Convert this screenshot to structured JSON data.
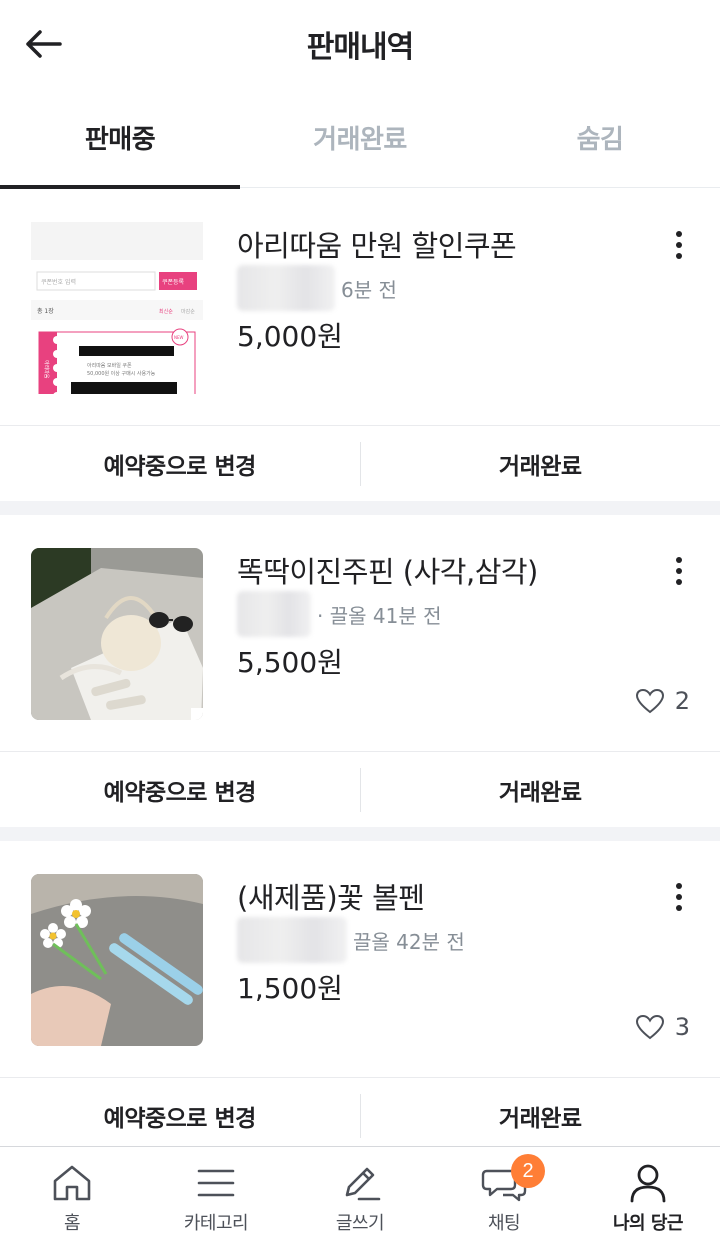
{
  "header": {
    "title": "판매내역"
  },
  "tabs": [
    {
      "label": "판매중",
      "active": true
    },
    {
      "label": "거래완료",
      "active": false
    },
    {
      "label": "숨김",
      "active": false
    }
  ],
  "items": [
    {
      "title": "아리따움 만원 할인쿠폰",
      "meta": "6분 전",
      "price": "5,000원",
      "likes": ""
    },
    {
      "title": "똑딱이진주핀 (사각,삼각)",
      "meta": "· 끌올 41분 전",
      "price": "5,500원",
      "likes": "2"
    },
    {
      "title": "(새제품)꽃 볼펜",
      "meta": "끌올 42분 전",
      "price": "1,500원",
      "likes": "3"
    }
  ],
  "actions": {
    "reserve": "예약중으로 변경",
    "complete": "거래완료"
  },
  "coupon_thumb": {
    "search_placeholder": "쿠폰번호 입력",
    "register": "쿠폰등록",
    "count": "총 1장",
    "sort1": "최신순",
    "sort2": "마감순",
    "new": "NEW",
    "line1": "50,000원 이상 구매시 사용가능",
    "brand": "아리따움 모바일 쿠폰",
    "vertical": "아리따움"
  },
  "bottom_nav": [
    {
      "label": "홈",
      "icon": "home-icon"
    },
    {
      "label": "카테고리",
      "icon": "menu-icon"
    },
    {
      "label": "글쓰기",
      "icon": "pencil-icon"
    },
    {
      "label": "채팅",
      "icon": "chat-icon",
      "badge": "2"
    },
    {
      "label": "나의 당근",
      "icon": "person-icon",
      "active": true
    }
  ],
  "colors": {
    "accent": "#ff7e36",
    "text": "#212124",
    "muted": "#868e96"
  }
}
